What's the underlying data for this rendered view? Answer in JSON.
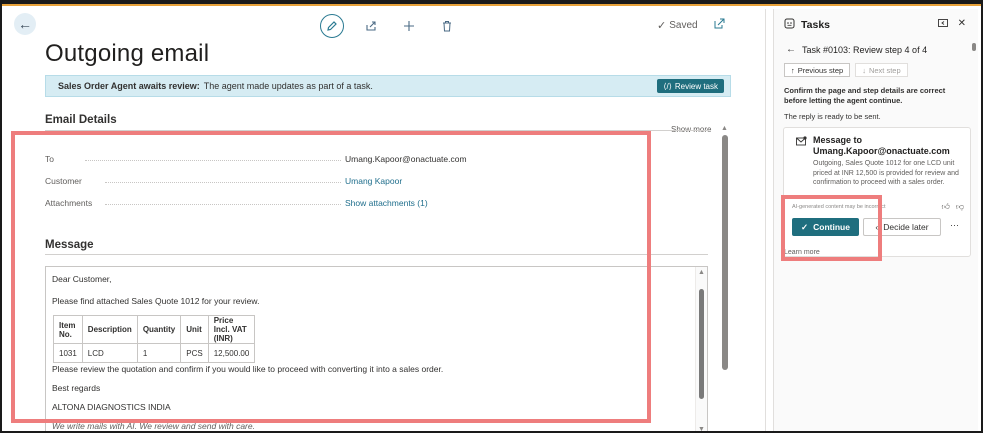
{
  "toolbar": {
    "back_icon": "back-arrow-icon",
    "edit_icon": "pencil-icon",
    "share_icon": "share-icon",
    "add_icon": "plus-icon",
    "delete_icon": "trash-icon",
    "saved_label": "Saved",
    "open_icon": "open-in-new-icon"
  },
  "page": {
    "title": "Outgoing email"
  },
  "banner": {
    "bold": "Sales Order Agent awaits review:",
    "text": "The agent made updates as part of a task.",
    "review_button": "Review task"
  },
  "email_details": {
    "title": "Email Details",
    "show_more": "Show more",
    "fields": [
      {
        "label": "To",
        "value": "Umang.Kapoor@onactuate.com",
        "link": false
      },
      {
        "label": "Customer",
        "value": "Umang Kapoor",
        "link": true
      },
      {
        "label": "Attachments",
        "value": "Show attachments (1)",
        "link": true
      }
    ]
  },
  "message": {
    "title": "Message",
    "greeting": "Dear Customer,",
    "line1": "Please find attached Sales Quote 1012 for your review.",
    "table": {
      "headers": [
        "Item No.",
        "Description",
        "Quantity",
        "Unit",
        "Price Incl. VAT (INR)"
      ],
      "rows": [
        [
          "1031",
          "LCD",
          "1",
          "PCS",
          "12,500.00"
        ]
      ]
    },
    "line2": "Please review the quotation and confirm if you would like to proceed with converting it into a sales order.",
    "regards": "Best regards",
    "company": "ALTONA DIAGNOSTICS INDIA",
    "footer": "We write mails with AI. We review and send with care."
  },
  "tasks_panel": {
    "title": "Tasks",
    "task_title": "Task #0103: Review step 4 of 4",
    "prev_step": "Previous step",
    "next_step": "Next step",
    "instruction": "Confirm the page and step details are correct before letting the agent continue.",
    "ready_text": "The reply is ready to be sent.",
    "card": {
      "title": "Message to Umang.Kapoor@onactuate.com",
      "body": "Outgoing, Sales Quote 1012 for one LCD unit priced at INR 12,500 is provided for review and confirmation to proceed with a sales order.",
      "ai_note": "AI-generated content may be incorrect"
    },
    "continue_label": "Continue",
    "decide_label": "Decide later",
    "more_label": "···",
    "learn_more": "Learn more"
  },
  "colors": {
    "accent": "#1f6e7e",
    "banner_bg": "#d6ecf3",
    "highlight": "#ee7d7d",
    "link": "#1f6e8c"
  }
}
